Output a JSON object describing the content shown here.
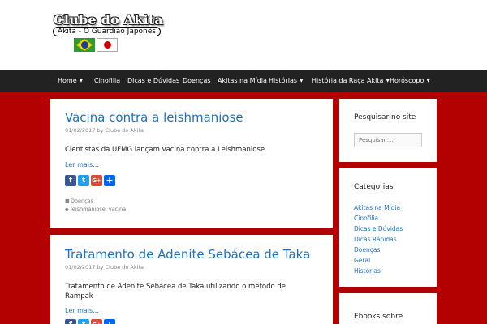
{
  "header": {
    "site_title": "Clube do Akita",
    "tagline": "Akita - O Guardião Japonês"
  },
  "nav": {
    "items": [
      {
        "label": "Home",
        "dropdown": true
      },
      {
        "label": "Cinofilia",
        "dropdown": false
      },
      {
        "label": "Dicas e Dúvidas",
        "dropdown": false
      },
      {
        "label": "Doenças",
        "dropdown": false
      },
      {
        "label": "Akitas na Mídia",
        "dropdown": false
      },
      {
        "label": "Histórias",
        "dropdown": true
      },
      {
        "label": "História da Raça Akita",
        "dropdown": true
      },
      {
        "label": "Horóscopo",
        "dropdown": true
      }
    ]
  },
  "posts": [
    {
      "title": "Vacina contra a leishmaniose",
      "date": "01/02/2017",
      "by": "by",
      "author": "Clube do Akita",
      "excerpt": "Cientistas da UFMG lançam vacina contra a Leishmaniose",
      "read_more": "Ler mais...",
      "category": "Doenças",
      "tags": "leishmaniose, vacina"
    },
    {
      "title": "Tratamento de Adenite Sebácea de Taka",
      "date": "01/02/2017",
      "by": "by",
      "author": "Clube do Akita",
      "excerpt": "Tratamento de Adenite Sebácea de Taka utilizando o método de Rampak",
      "read_more": "Ler mais..."
    }
  ],
  "sidebar": {
    "search": {
      "title": "Pesquisar no site",
      "placeholder": "Pesquisar ..."
    },
    "categories": {
      "title": "Categorias",
      "items": [
        "Akitas na Mídia",
        "Cinofilia",
        "Dicas e Dúvidas",
        "Dicas Rápidas",
        "Doenças",
        "Geral",
        "Histórias"
      ]
    },
    "ebooks": {
      "title": "Ebooks sobre"
    }
  },
  "colors": {
    "background": "#b30000",
    "nav": "#222222",
    "link": "#1e72bd"
  }
}
